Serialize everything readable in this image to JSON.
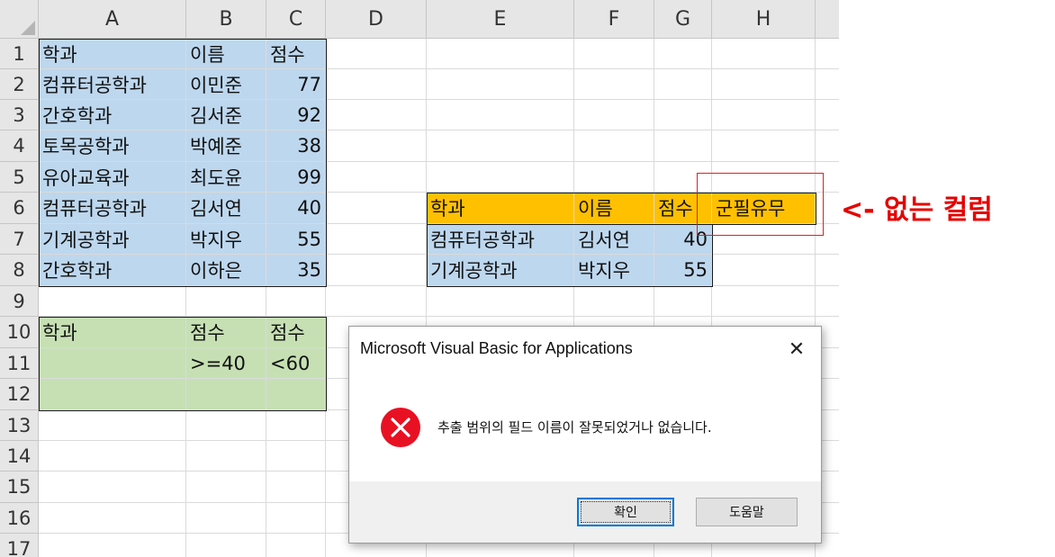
{
  "columns": [
    "A",
    "B",
    "C",
    "D",
    "E",
    "F",
    "G",
    "H"
  ],
  "rows": [
    "1",
    "2",
    "3",
    "4",
    "5",
    "6",
    "7",
    "8",
    "9",
    "10",
    "11",
    "12",
    "13",
    "14",
    "15",
    "16",
    "17"
  ],
  "main_table": {
    "header": [
      "학과",
      "이름",
      "점수"
    ],
    "rows": [
      [
        "컴퓨터공학과",
        "이민준",
        "77"
      ],
      [
        "간호학과",
        "김서준",
        "92"
      ],
      [
        "토목공학과",
        "박예준",
        "38"
      ],
      [
        "유아교육과",
        "최도윤",
        "99"
      ],
      [
        "컴퓨터공학과",
        "김서연",
        "40"
      ],
      [
        "기계공학과",
        "박지우",
        "55"
      ],
      [
        "간호학과",
        "이하은",
        "35"
      ]
    ]
  },
  "criteria_table": {
    "header": [
      "학과",
      "점수",
      "점수"
    ],
    "rows": [
      [
        "",
        ">=40",
        "<60"
      ],
      [
        "",
        "",
        ""
      ]
    ]
  },
  "extract_table": {
    "header": [
      "학과",
      "이름",
      "점수",
      "군필유무"
    ],
    "rows": [
      [
        "컴퓨터공학과",
        "김서연",
        "40"
      ],
      [
        "기계공학과",
        "박지우",
        "55"
      ]
    ]
  },
  "annotation": "<- 없는 컬럼",
  "dialog": {
    "title": "Microsoft Visual Basic for Applications",
    "close": "✕",
    "message": "추출 범위의 필드 이름이 잘못되었거나 없습니다.",
    "ok_label": "확인",
    "help_label": "도움말"
  },
  "colors": {
    "blue_fill": "#bdd7ee",
    "green_fill": "#c6e0b4",
    "orange_fill": "#ffc000",
    "annotation_red": "#e60000",
    "error_icon": "#e81123"
  }
}
